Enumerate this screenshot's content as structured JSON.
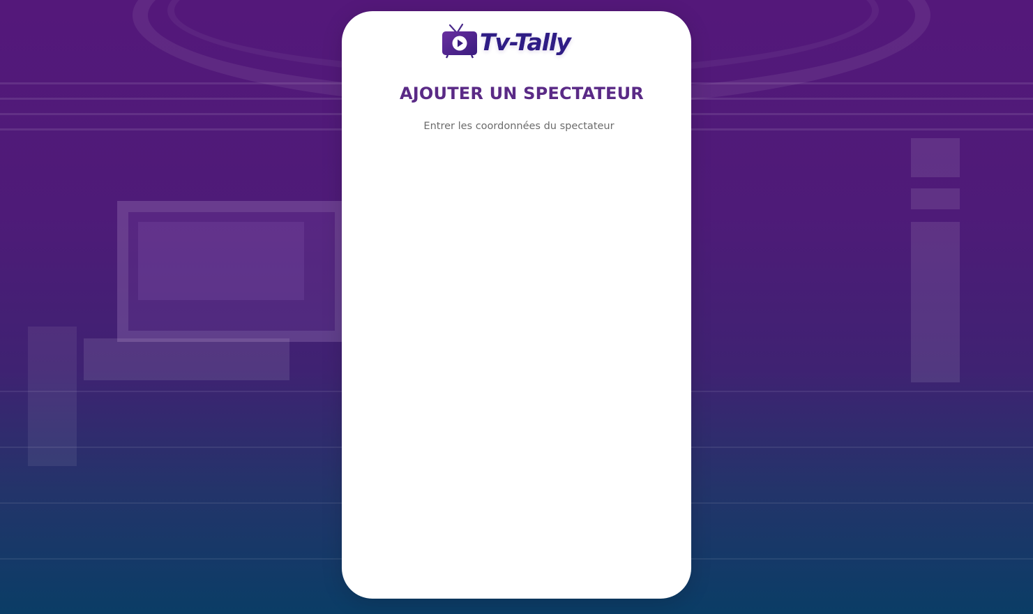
{
  "brand": {
    "name": "Tv-Tally",
    "logo_icon": "tv-play-icon",
    "color_primary": "#5a2a86",
    "color_logo": "#2f1d85"
  },
  "form": {
    "title": "AJOUTER UN SPECTATEUR",
    "subtitle": "Entrer les coordonnées du spectateur"
  },
  "theme": {
    "background_gradient_top": "#54187a",
    "background_gradient_bottom": "#0a3d66",
    "card_color": "#ffffff"
  }
}
